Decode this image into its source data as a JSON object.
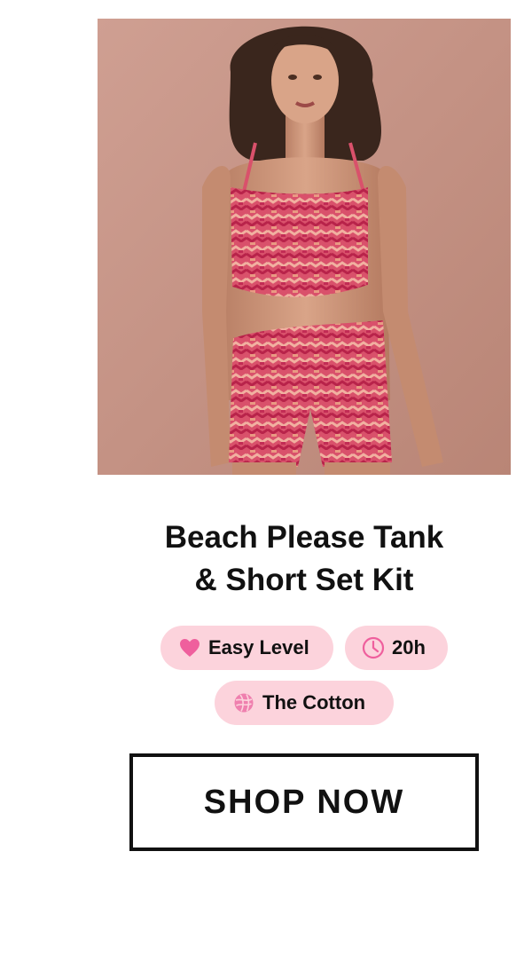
{
  "product": {
    "title_line1": "Beach Please Tank",
    "title_line2": "& Short Set Kit",
    "image_icon": "product-photo"
  },
  "badges": {
    "level": {
      "label": "Easy Level",
      "icon": "heart-icon",
      "color": "#ef5f9d"
    },
    "time": {
      "label": "20h",
      "icon": "clock-icon",
      "color": "#ef5f9d"
    },
    "yarn": {
      "label": "The Cotton",
      "icon": "yarn-ball-icon",
      "color": "#ef5f9d"
    }
  },
  "cta": {
    "label": "SHOP NOW"
  },
  "colors": {
    "badge_background": "#fcd3dc",
    "text": "#111111",
    "accent": "#ef5f9d"
  }
}
